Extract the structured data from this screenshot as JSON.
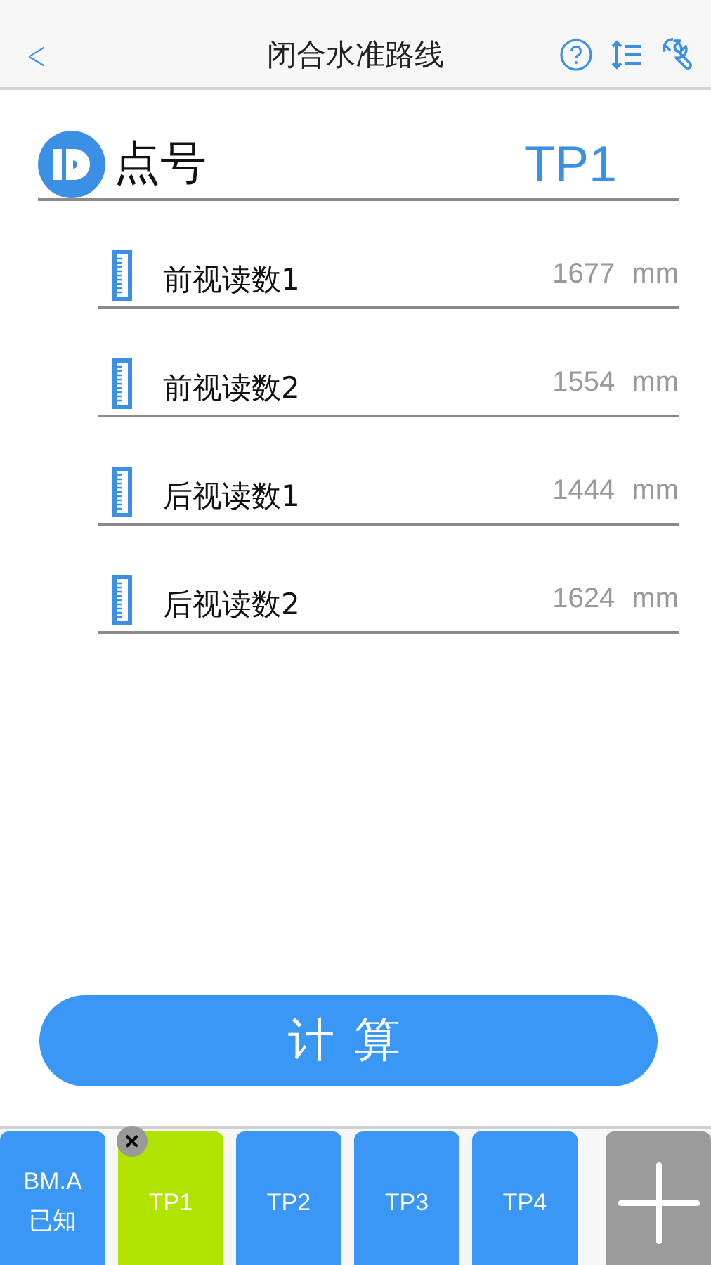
{
  "header": {
    "back": "<",
    "title": "闭合水准路线"
  },
  "point": {
    "label": "点号",
    "value": "TP1"
  },
  "readings": [
    {
      "label": "前视读数1",
      "value": "1677",
      "unit": "mm"
    },
    {
      "label": "前视读数2",
      "value": "1554",
      "unit": "mm"
    },
    {
      "label": "后视读数1",
      "value": "1444",
      "unit": "mm"
    },
    {
      "label": "后视读数2",
      "value": "1624",
      "unit": "mm"
    }
  ],
  "calculate_button": "计算",
  "stations": [
    {
      "kind": "point",
      "lines": [
        "BM.A",
        "已知"
      ],
      "selected": false
    },
    {
      "kind": "point",
      "lines": [
        "TP1"
      ],
      "selected": true,
      "remove": "✕"
    },
    {
      "kind": "point",
      "lines": [
        "TP2"
      ],
      "selected": false
    },
    {
      "kind": "point",
      "lines": [
        "TP3"
      ],
      "selected": false
    },
    {
      "kind": "point",
      "lines": [
        "TP4"
      ],
      "selected": false
    },
    {
      "kind": "add"
    }
  ]
}
